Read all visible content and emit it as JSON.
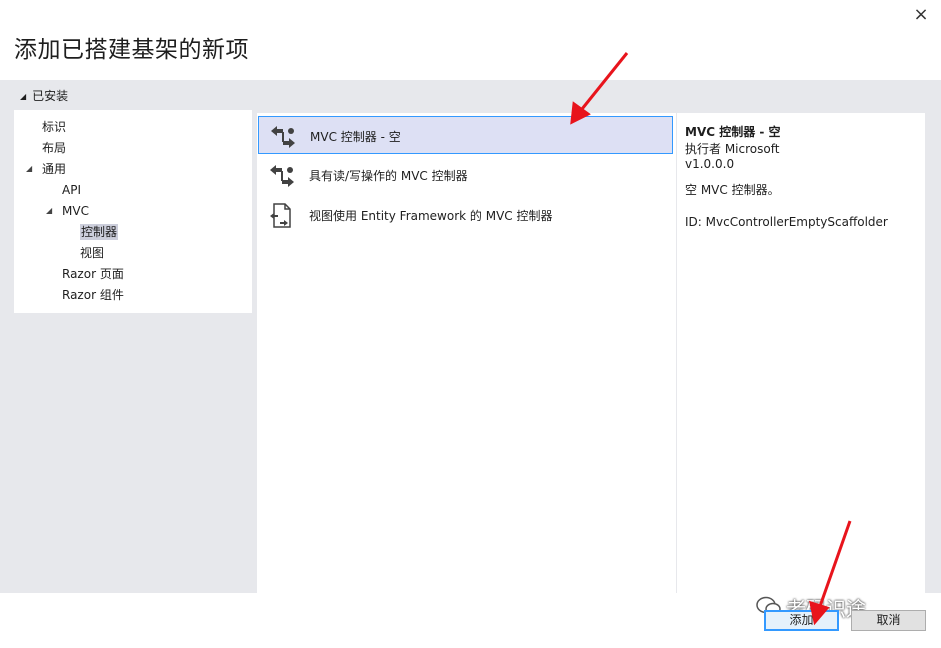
{
  "dialog": {
    "title": "添加已搭建基架的新项",
    "close_glyph": "×"
  },
  "tree": {
    "header": "已安装",
    "items": [
      {
        "label": "标识"
      },
      {
        "label": "布局"
      },
      {
        "label": "通用"
      },
      {
        "label": "API"
      },
      {
        "label": "MVC"
      },
      {
        "label": "控制器"
      },
      {
        "label": "视图"
      },
      {
        "label": "Razor 页面"
      },
      {
        "label": "Razor 组件"
      }
    ]
  },
  "templates": [
    {
      "label": "MVC 控制器 - 空",
      "icon": "controller-icon"
    },
    {
      "label": "具有读/写操作的 MVC 控制器",
      "icon": "controller-icon"
    },
    {
      "label": "视图使用 Entity Framework 的 MVC 控制器",
      "icon": "scaffold-document-icon"
    }
  ],
  "details": {
    "name": "MVC 控制器 - 空",
    "author": "执行者 Microsoft",
    "version": "v1.0.0.0",
    "description": "空 MVC 控制器。",
    "id": "ID: MvcControllerEmptyScaffolder"
  },
  "buttons": {
    "add": "添加",
    "cancel": "取消"
  },
  "watermark": {
    "text": "老码识途"
  },
  "colors": {
    "selection_bg": "#dde0f4",
    "selection_border": "#3399ff",
    "arrow": "#e8141c"
  }
}
